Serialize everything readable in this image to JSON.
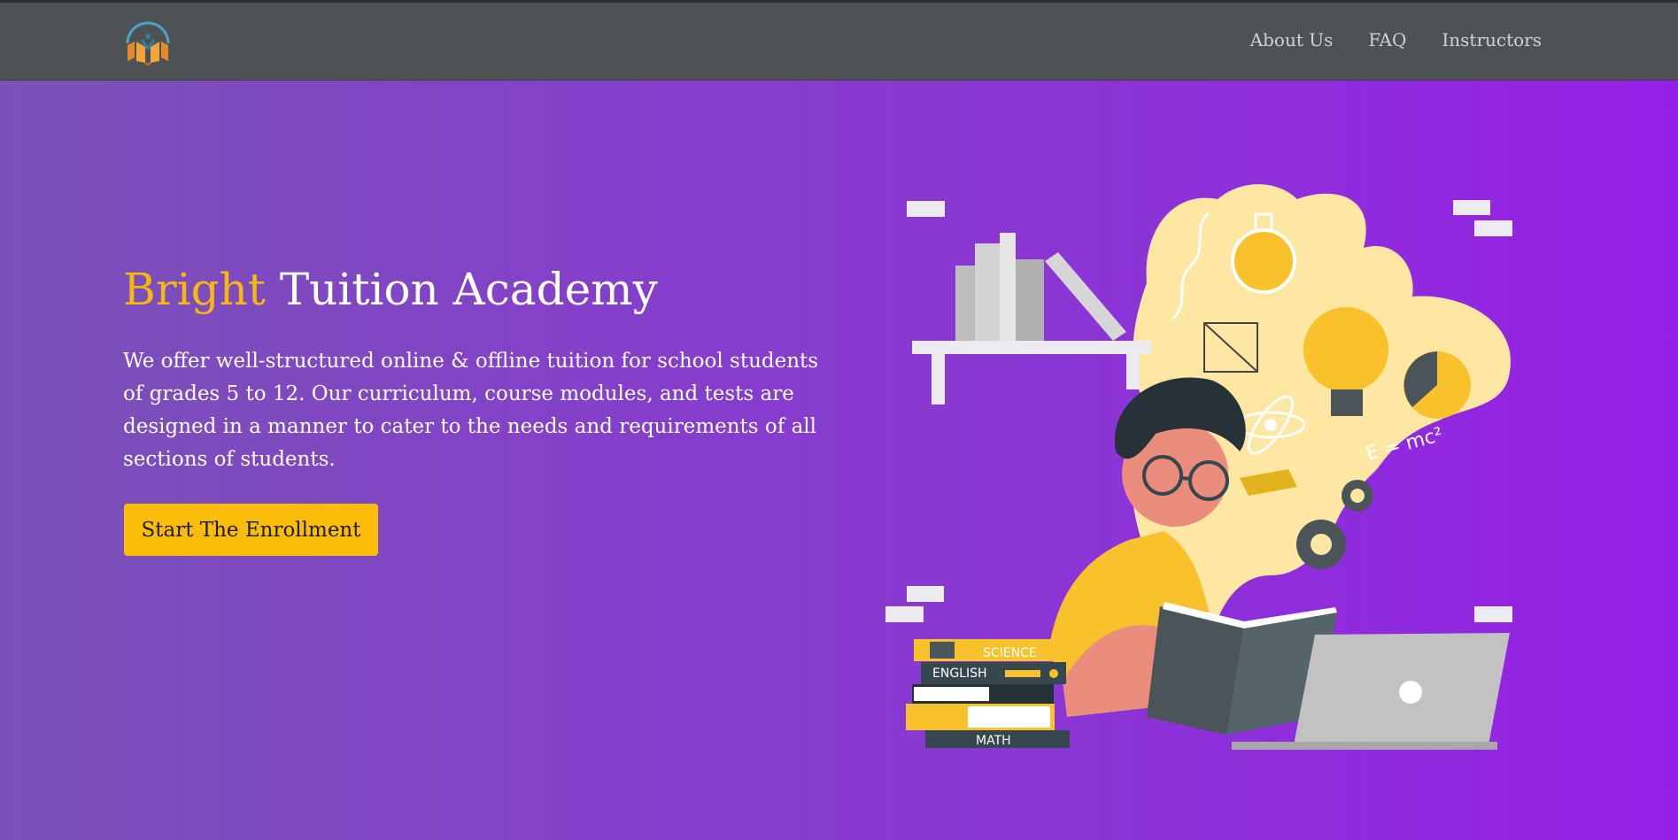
{
  "header": {
    "logo_icon": "academy-logo-icon",
    "nav": [
      {
        "label": "About Us"
      },
      {
        "label": "FAQ"
      },
      {
        "label": "Instructors"
      }
    ]
  },
  "hero": {
    "title_accent": "Bright",
    "title_rest": " Tuition Academy",
    "description": "We offer well-structured online & offline tuition for school students of grades 5 to 12. Our curriculum, course modules, and tests are designed in a manner to cater to the needs and requirements of all sections of students.",
    "cta_label": "Start The Enrollment"
  },
  "illustration": {
    "book_labels": [
      "SCIENCE",
      "ENGLISH",
      "MATH"
    ],
    "formula": "E = mc²",
    "icon": "student-studying-illustration"
  },
  "colors": {
    "accent": "#fcbc0a",
    "header": "#4f5255",
    "hero_start": "#7a52b7",
    "hero_end": "#961fe6"
  }
}
